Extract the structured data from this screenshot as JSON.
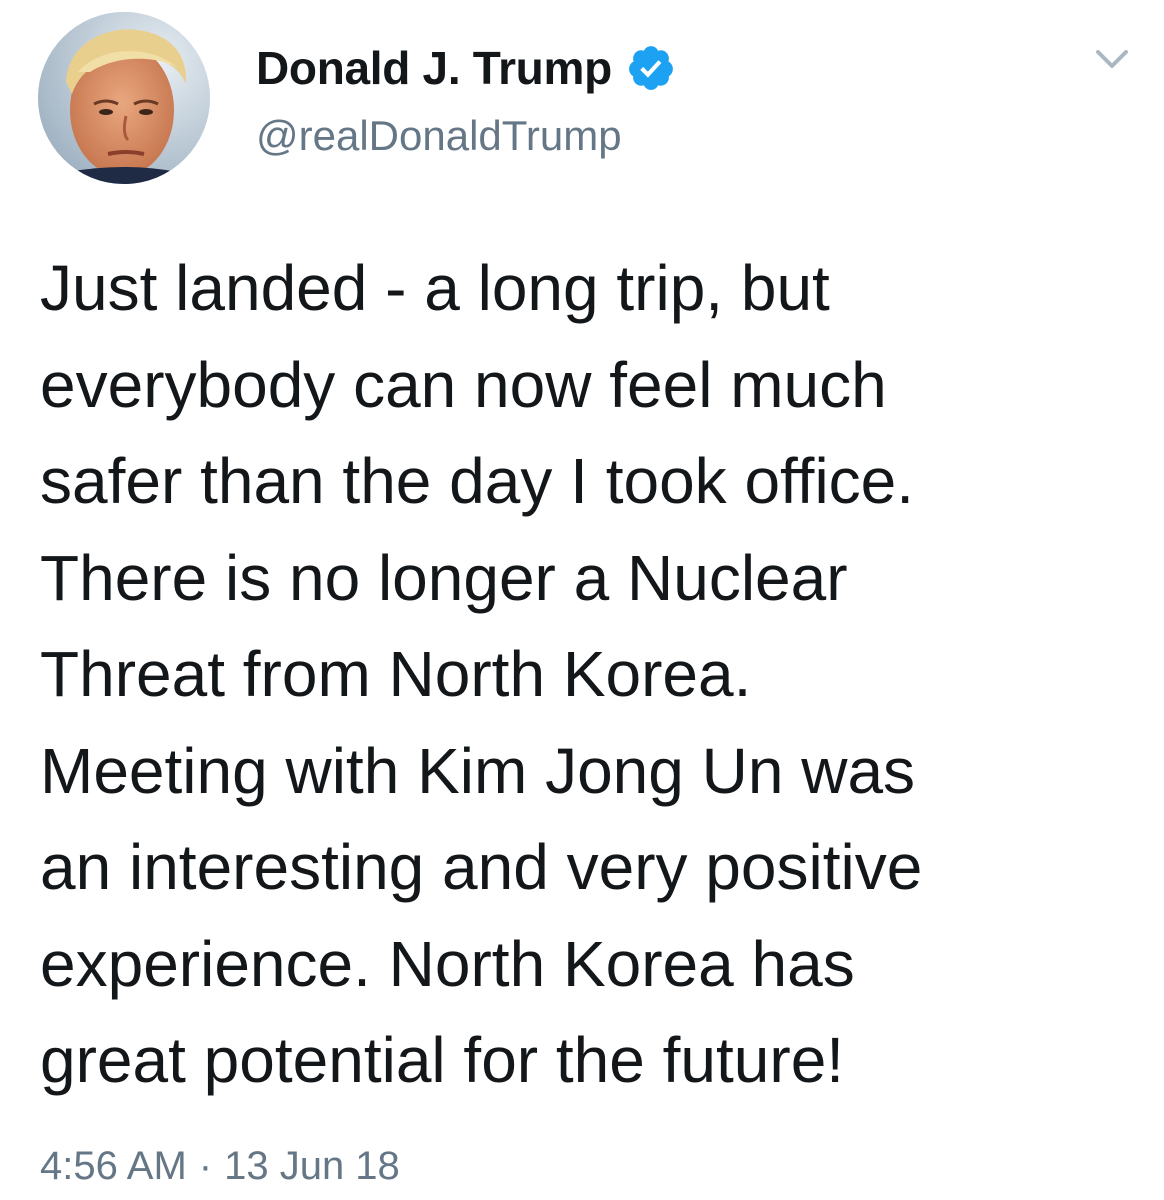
{
  "author": {
    "display_name": "Donald J. Trump",
    "handle": "@realDonaldTrump",
    "verified": true,
    "verified_color": "#1da1f2",
    "avatar_icon": "profile-photo"
  },
  "menu": {
    "icon": "chevron-down-icon"
  },
  "tweet": {
    "lines": [
      "Just landed - a long trip, but",
      "everybody can now feel much",
      "safer than the day I took office.",
      "There is no longer a Nuclear",
      "Threat from North Korea.",
      "Meeting with Kim Jong Un was",
      "an interesting and very positive",
      "experience. North Korea has",
      "great potential for the future!"
    ]
  },
  "meta": {
    "time": "4:56 AM",
    "separator": "·",
    "date": "13 Jun 18"
  },
  "colors": {
    "text": "#14171a",
    "secondary": "#657786",
    "accent": "#1da1f2"
  }
}
